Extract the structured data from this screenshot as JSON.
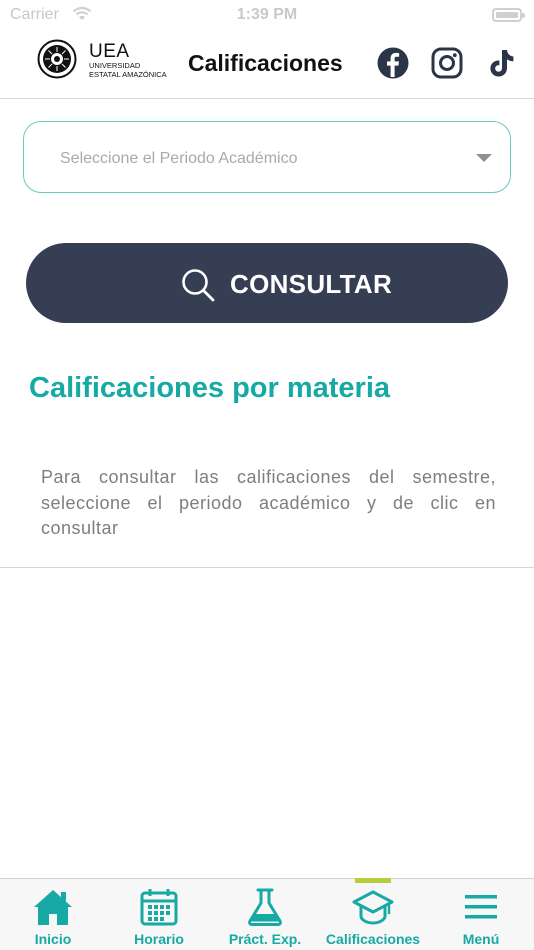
{
  "status_bar": {
    "carrier": "Carrier",
    "time": "1:39 PM"
  },
  "header": {
    "logo": {
      "abbr": "UEA",
      "line1": "UNIVERSIDAD",
      "line2": "ESTATAL AMAZÓNICA"
    },
    "title": "Calificaciones",
    "social_icons": [
      "facebook-icon",
      "instagram-icon",
      "tiktok-icon"
    ]
  },
  "period_select": {
    "placeholder": "Seleccione el Periodo Académico"
  },
  "consult_button": {
    "label": "CONSULTAR"
  },
  "section": {
    "title": "Calificaciones por materia",
    "info": "Para consultar las calificaciones del semestre, seleccione el periodo académico y de clic en consultar"
  },
  "bottom_nav": {
    "items": [
      {
        "label": "Inicio",
        "icon": "home-icon"
      },
      {
        "label": "Horario",
        "icon": "calendar-icon"
      },
      {
        "label": "Práct. Exp.",
        "icon": "flask-icon"
      },
      {
        "label": "Calificaciones",
        "icon": "graduation-cap-icon",
        "active": true
      },
      {
        "label": "Menú",
        "icon": "hamburger-menu-icon"
      }
    ]
  },
  "colors": {
    "accent": "#17a9a3",
    "button": "#353e52",
    "active_indicator": "#b6ce3a",
    "select_border": "#6cc8bf"
  }
}
